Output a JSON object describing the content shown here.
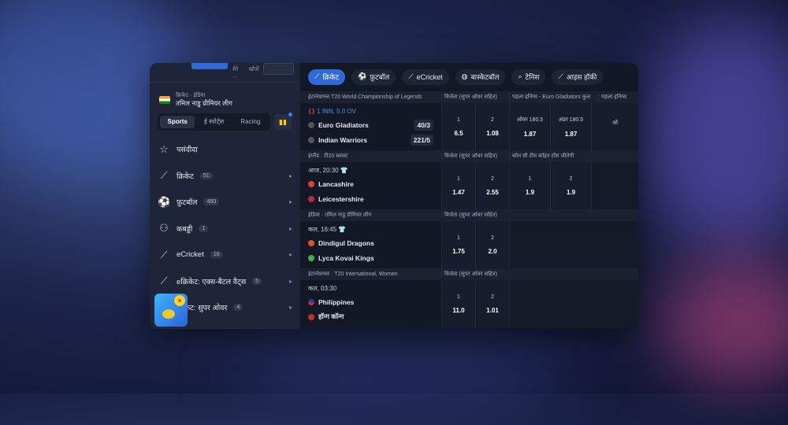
{
  "sidebar": {
    "top_labels": [
      "मेरे ...",
      "खोजें"
    ],
    "league": {
      "country": "क्रिकेट · इंडिया",
      "name": "तमिल नाडु प्रीमियर लीग"
    },
    "segments": [
      {
        "label": "Sports",
        "active": true
      },
      {
        "label": "ई स्पोर्ट्स",
        "active": false
      },
      {
        "label": "Racing",
        "active": false
      }
    ],
    "items": [
      {
        "label": "पसंदीदा",
        "count": "",
        "icon": "star-icon",
        "glyph": "☆"
      },
      {
        "label": "क्रिकेट",
        "count": "51",
        "icon": "cricket-bat-icon",
        "glyph": "⚲"
      },
      {
        "label": "फ़ुटबॉल",
        "count": "460",
        "icon": "football-icon",
        "glyph": "⚽"
      },
      {
        "label": "कबड्डी",
        "count": "1",
        "icon": "kabaddi-icon",
        "glyph": "⚇"
      },
      {
        "label": "eCricket",
        "count": "16",
        "icon": "ecricket-icon",
        "glyph": "⚲"
      },
      {
        "label": "eक्रिकेट: एक्स-बैटल वैट्स",
        "count": "5",
        "icon": "ecricket-battle-icon",
        "glyph": "⚲"
      },
      {
        "label": "क्रिकेट: सुपर ओवर",
        "count": "4",
        "icon": "super-over-icon",
        "glyph": "⚲"
      }
    ]
  },
  "tabs": [
    {
      "label": "क्रिकेट",
      "icon": "cricket-icon",
      "glyph": "⚲",
      "active": true
    },
    {
      "label": "फ़ुटबॉल",
      "icon": "football-icon",
      "glyph": "⚽",
      "active": false
    },
    {
      "label": "eCricket",
      "icon": "ecricket-icon",
      "glyph": "⚲",
      "active": false
    },
    {
      "label": "बास्केटबॉल",
      "icon": "basketball-icon",
      "glyph": "◍",
      "active": false
    },
    {
      "label": "टेनिस",
      "icon": "tennis-icon",
      "glyph": "⌕",
      "active": false
    },
    {
      "label": "आइस हॉकी",
      "icon": "hockey-icon",
      "glyph": "⟋",
      "active": false
    }
  ],
  "sections": [
    {
      "league": "इंटरनेशनल T20 World Championship of Legends",
      "markets": [
        "विजेता (सुपर ओवर सहित)",
        "पहला इनिंग्स - Euro Gladiators कुल",
        "पहला इनिंग्स"
      ],
      "match": {
        "time": "1 INN, 5.0 OV",
        "live": true,
        "team1": "Euro Gladiators",
        "score1": "40/3",
        "team2": "Indian Warriors",
        "score2": "221/5",
        "odds": [
          {
            "label": "1",
            "value": "6.5"
          },
          {
            "label": "2",
            "value": "1.08"
          },
          {
            "label": "ओवर 180.5",
            "value": "1.87"
          },
          {
            "label": "अंडर 180.5",
            "value": "1.87"
          },
          {
            "label": "ओ",
            "value": ""
          }
        ]
      }
    },
    {
      "league": "इंग्लैंड · टी20 ब्लास्ट",
      "markets": [
        "विजेता (सुपर ओवर सहित)",
        "कौन सी टीम कॉइन टॉस जीतेगी"
      ],
      "match": {
        "time": "आज, 20:30",
        "live": false,
        "team1": "Lancashire",
        "score1": "",
        "team2": "Leicestershire",
        "score2": "",
        "odds": [
          {
            "label": "1",
            "value": "1.47"
          },
          {
            "label": "2",
            "value": "2.55"
          },
          {
            "label": "1",
            "value": "1.9"
          },
          {
            "label": "2",
            "value": "1.9"
          }
        ]
      }
    },
    {
      "league": "इंडिया · तमिल नाडु प्रीमियर लीग",
      "markets": [
        "विजेता (सुपर ओवर सहित)"
      ],
      "match": {
        "time": "कल, 16:45",
        "live": false,
        "team1": "Dindigul Dragons",
        "score1": "",
        "team2": "Lyca Kovai Kings",
        "score2": "",
        "odds": [
          {
            "label": "1",
            "value": "1.75"
          },
          {
            "label": "2",
            "value": "2.0"
          }
        ]
      }
    },
    {
      "league": "इंटरनेशनल · T20 International, Women",
      "markets": [
        "विजेता (सुपर ओवर सहित)"
      ],
      "match": {
        "time": "कल, 03:30",
        "live": false,
        "team1": "Philippines",
        "score1": "",
        "team2": "हॉन्ग कॉन्ग",
        "score2": "",
        "odds": [
          {
            "label": "1",
            "value": "11.0"
          },
          {
            "label": "2",
            "value": "1.01"
          }
        ]
      }
    }
  ],
  "colors": {
    "accent": "#2f6ad8",
    "live": "#4d8dff",
    "panel": "#151b2a"
  }
}
